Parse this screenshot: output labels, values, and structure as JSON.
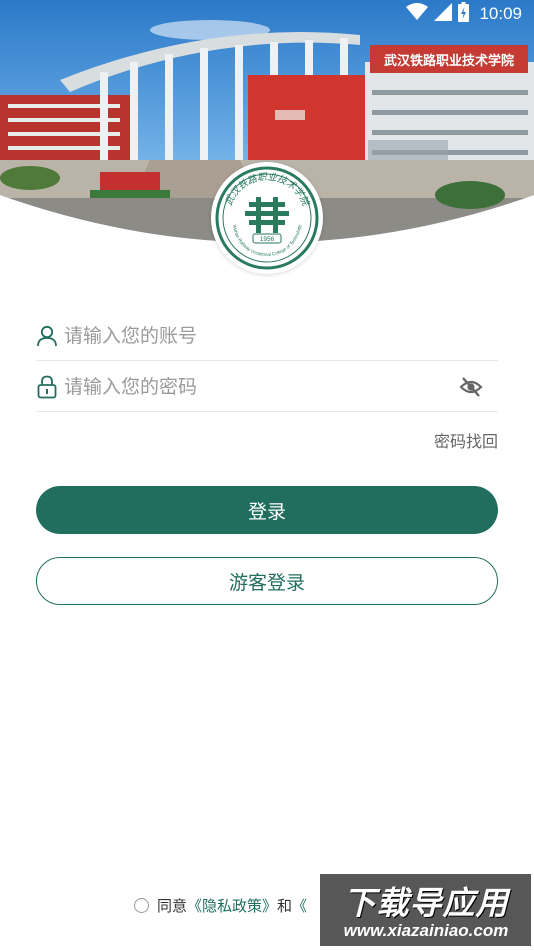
{
  "status_bar": {
    "time": "10:09",
    "icons": [
      "wifi-icon",
      "cellular-signal-icon",
      "battery-charging-icon"
    ]
  },
  "header": {
    "building_sign": "武汉铁路职业技术学院"
  },
  "logo": {
    "name_cn": "武汉铁路职业技术学院",
    "name_en": "Wuhan Railway Vocational College of Technology",
    "year": "1956"
  },
  "form": {
    "account": {
      "value": "",
      "placeholder": "请输入您的账号",
      "icon": "user-icon"
    },
    "password": {
      "value": "",
      "placeholder": "请输入您的密码",
      "icon": "lock-icon",
      "toggle_icon": "eye-off-icon"
    },
    "forgot_label": "密码找回",
    "login_label": "登录",
    "guest_label": "游客登录"
  },
  "agreement": {
    "agree_label": "同意",
    "privacy_link": "《隐私政策》",
    "and_label": "和",
    "service_link": "《"
  },
  "watermark": {
    "main": "下载导应用",
    "url": "www.xiazainiao.com"
  },
  "colors": {
    "primary": "#216e5e",
    "placeholder": "#9a9a9a",
    "divider": "#e8e8e8"
  }
}
